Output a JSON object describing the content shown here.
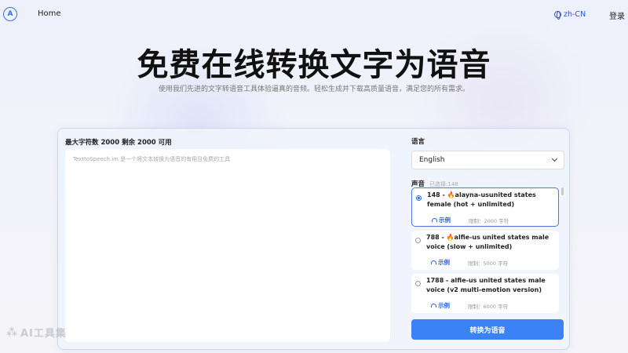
{
  "header": {
    "logo_text": "A",
    "nav_home": "Home",
    "lang": "zh-CN",
    "login": "登录"
  },
  "hero": {
    "title": "免费在线转换文字为语音",
    "subtitle": "使用我们先进的文字转语音工具体验逼真的音频。轻松生成并下载高质量语音，满足您的所有需求。"
  },
  "editor": {
    "char_info": "最大字符数 2000 剩余 2000 可用",
    "placeholder": "TexttoSpeech.im 是一个将文本转换为语音的有用且免费的工具"
  },
  "language": {
    "label": "语言",
    "selected": "English"
  },
  "voices": {
    "label": "声音",
    "selected_count": "已选择:148",
    "items": [
      {
        "name": "148 - 🔥alayna-usunited states female (hot + unlimited)",
        "sample": "示例",
        "limit": "限制：2000 字符",
        "selected": true
      },
      {
        "name": "788 - 🔥alfie-us united states male voice (slow + unlimited)",
        "sample": "示例",
        "limit": "限制：5000 字符",
        "selected": false
      },
      {
        "name": "1788 - alfie-us united states male voice (v2 multi-emotion version)",
        "sample": "示例",
        "limit": "限制：6000 字符",
        "selected": false
      }
    ]
  },
  "convert_button": "转换为语音",
  "watermark": "AI工具集",
  "colors": {
    "accent": "#3a82f6",
    "link": "#2b56c6"
  }
}
